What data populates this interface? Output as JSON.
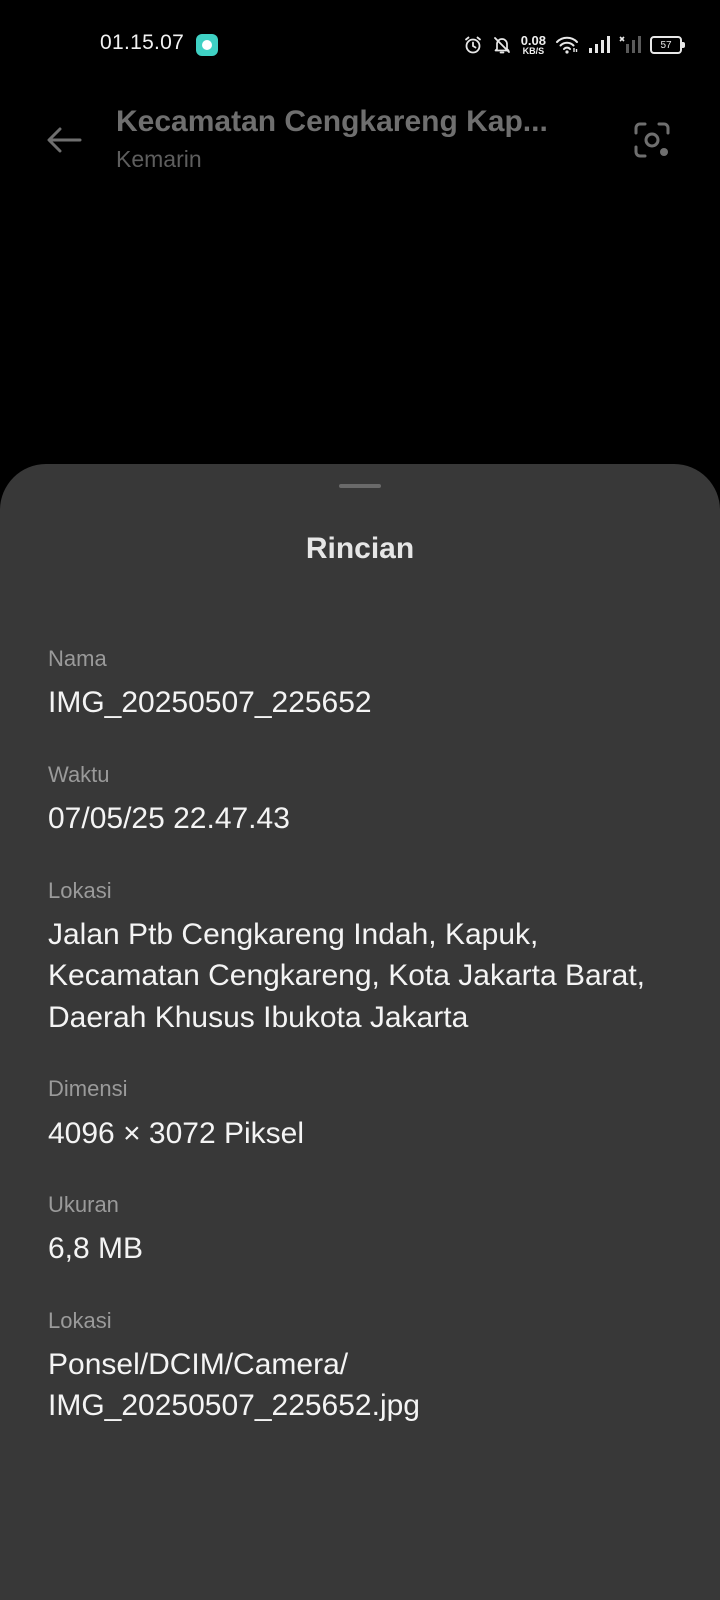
{
  "status_bar": {
    "time": "01.15.07",
    "net_speed_value": "0.08",
    "net_speed_unit": "KB/S",
    "battery_level": "57",
    "icons": [
      "app-notification-icon",
      "alarm-icon",
      "bell-muted-icon",
      "wifi-icon",
      "signal-icon",
      "signal-no-service-icon",
      "battery-icon"
    ]
  },
  "app_bar": {
    "title": "Kecamatan Cengkareng Kap...",
    "subtitle": "Kemarin",
    "back_icon": "arrow-left-icon",
    "lens_icon": "lens-scan-icon"
  },
  "sheet": {
    "title": "Rincian",
    "details": [
      {
        "label": "Nama",
        "value": "IMG_20250507_225652"
      },
      {
        "label": "Waktu",
        "value": "07/05/25 22.47.43"
      },
      {
        "label": "Lokasi",
        "value": "Jalan Ptb Cengkareng Indah, Kapuk,\nKecamatan Cengkareng, Kota Jakarta Barat,\nDaerah Khusus Ibukota Jakarta"
      },
      {
        "label": "Dimensi",
        "value": "4096 × 3072 Piksel"
      },
      {
        "label": "Ukuran",
        "value": "6,8 MB"
      },
      {
        "label": "Lokasi",
        "value": "Ponsel/DCIM/Camera/\nIMG_20250507_225652.jpg"
      }
    ]
  },
  "colors": {
    "background": "#000000",
    "sheet": "#383838",
    "label": "#9a9a9a",
    "value": "#f4f4f4",
    "app_badge": "#3fd1c4"
  }
}
